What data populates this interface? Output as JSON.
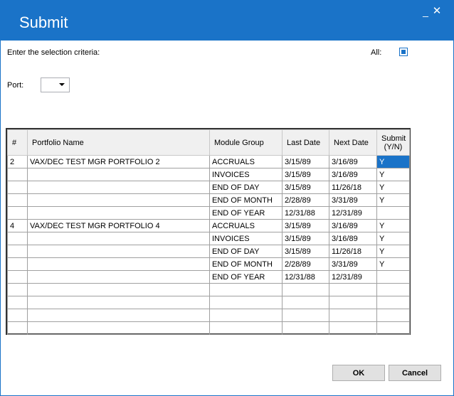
{
  "window": {
    "title": "Submit",
    "minimize_glyph": "_",
    "close_glyph": "✕",
    "accent_color": "#1a73c8"
  },
  "criteria": {
    "prompt": "Enter the selection criteria:",
    "all_label": "All:",
    "all_checked": true,
    "port_label": "Port:",
    "port_value": ""
  },
  "table": {
    "headers": [
      "#",
      "Portfolio Name",
      "Module Group",
      "Last Date",
      "Next Date",
      "Submit (Y/N)"
    ],
    "rows": [
      [
        "2",
        "VAX/DEC TEST MGR PORTFOLIO 2",
        "ACCRUALS",
        "3/15/89",
        "3/16/89",
        "Y"
      ],
      [
        "",
        "",
        "INVOICES",
        "3/15/89",
        "3/16/89",
        "Y"
      ],
      [
        "",
        "",
        "END OF DAY",
        "3/15/89",
        "11/26/18",
        "Y"
      ],
      [
        "",
        "",
        "END OF MONTH",
        "2/28/89",
        "3/31/89",
        "Y"
      ],
      [
        "",
        "",
        "END OF YEAR",
        "12/31/88",
        "12/31/89",
        ""
      ],
      [
        "4",
        "VAX/DEC TEST MGR PORTFOLIO 4",
        "ACCRUALS",
        "3/15/89",
        "3/16/89",
        "Y"
      ],
      [
        "",
        "",
        "INVOICES",
        "3/15/89",
        "3/16/89",
        "Y"
      ],
      [
        "",
        "",
        "END OF DAY",
        "3/15/89",
        "11/26/18",
        "Y"
      ],
      [
        "",
        "",
        "END OF MONTH",
        "2/28/89",
        "3/31/89",
        "Y"
      ],
      [
        "",
        "",
        "END OF YEAR",
        "12/31/88",
        "12/31/89",
        ""
      ],
      [
        "",
        "",
        "",
        "",
        "",
        ""
      ],
      [
        "",
        "",
        "",
        "",
        "",
        ""
      ],
      [
        "",
        "",
        "",
        "",
        "",
        ""
      ],
      [
        "",
        "",
        "",
        "",
        "",
        ""
      ]
    ]
  },
  "buttons": {
    "ok": "OK",
    "cancel": "Cancel"
  }
}
